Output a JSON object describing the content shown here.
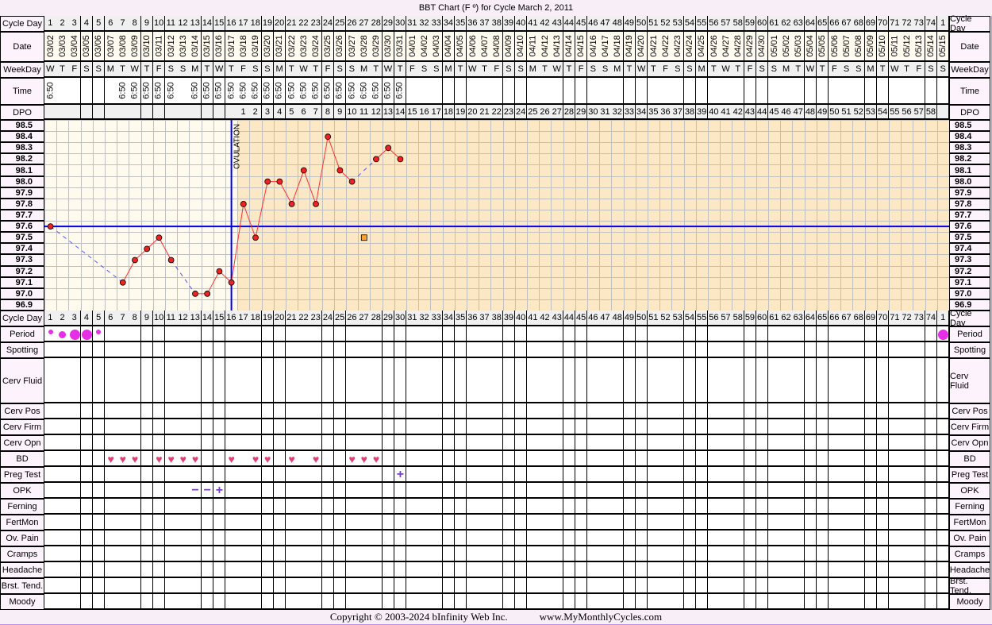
{
  "title": "BBT Chart (F º) for Cycle March 2, 2011",
  "copyright": "Copyright © 2003-2024 bInfinity Web Inc.",
  "site": "www.MyMonthlyCycles.com",
  "labels": {
    "cycle_day": "Cycle Day",
    "date": "Date",
    "weekday": "WeekDay",
    "time": "Time",
    "dpo": "DPO",
    "ovulation": "OVULATION"
  },
  "bottom_rows": [
    "Period",
    "Spotting",
    "Cerv Fluid",
    "Cerv Pos",
    "Cerv Firm",
    "Cerv Opn",
    "BD",
    "Preg Test",
    "OPK",
    "Ferning",
    "FertMon",
    "Ov. Pain",
    "Cramps",
    "Headache",
    "Brst. Tend.",
    "Moody"
  ],
  "colors": {
    "pre_ovulation": "#fffaee",
    "post_ovulation": "#fde8c5",
    "temp_line": "#ff3333",
    "coverline": "#0000ee",
    "period": "#e62ee6",
    "bd": "#e0407a",
    "opk": "#7a3fc0"
  },
  "chart_data": {
    "type": "line",
    "title": "BBT Chart (F º) for Cycle March 2, 2011",
    "ylim": [
      96.9,
      98.5
    ],
    "y_ticks": [
      "98.5",
      "98.4",
      "98.3",
      "98.2",
      "98.1",
      "98.0",
      "97.9",
      "97.8",
      "97.7",
      "97.6",
      "97.5",
      "97.4",
      "97.3",
      "97.2",
      "97.1",
      "97.0",
      "96.9"
    ],
    "grid": true,
    "cycle_days": [
      "1",
      "2",
      "3",
      "4",
      "5",
      "6",
      "7",
      "8",
      "9",
      "10",
      "11",
      "12",
      "13",
      "14",
      "15",
      "16",
      "17",
      "18",
      "19",
      "20",
      "21",
      "22",
      "23",
      "24",
      "25",
      "26",
      "27",
      "28",
      "29",
      "30",
      "31",
      "32",
      "33",
      "34",
      "35",
      "36",
      "37",
      "38",
      "39",
      "40",
      "41",
      "42",
      "43",
      "44",
      "45",
      "46",
      "47",
      "48",
      "49",
      "50",
      "51",
      "52",
      "53",
      "54",
      "55",
      "56",
      "57",
      "58",
      "59",
      "60",
      "61",
      "62",
      "63",
      "64",
      "65",
      "66",
      "67",
      "68",
      "69",
      "70",
      "71",
      "72",
      "73",
      "74",
      "1"
    ],
    "dates": [
      "03/02",
      "03/03",
      "03/04",
      "03/05",
      "03/06",
      "03/07",
      "03/08",
      "03/09",
      "03/10",
      "03/11",
      "03/12",
      "03/13",
      "03/14",
      "03/15",
      "03/16",
      "03/17",
      "03/18",
      "03/19",
      "03/20",
      "03/21",
      "03/22",
      "03/23",
      "03/24",
      "03/25",
      "03/26",
      "03/27",
      "03/28",
      "03/29",
      "03/30",
      "03/31",
      "04/01",
      "04/02",
      "04/03",
      "04/04",
      "04/05",
      "04/06",
      "04/07",
      "04/08",
      "04/09",
      "04/10",
      "04/11",
      "04/12",
      "04/13",
      "04/14",
      "04/15",
      "04/16",
      "04/17",
      "04/18",
      "04/19",
      "04/20",
      "04/21",
      "04/22",
      "04/23",
      "04/24",
      "04/25",
      "04/26",
      "04/27",
      "04/28",
      "04/29",
      "04/30",
      "05/01",
      "05/02",
      "05/03",
      "05/04",
      "05/05",
      "05/06",
      "05/07",
      "05/08",
      "05/09",
      "05/10",
      "05/11",
      "05/12",
      "05/13",
      "05/14",
      "05/15"
    ],
    "weekdays": [
      "W",
      "T",
      "F",
      "S",
      "S",
      "M",
      "T",
      "W",
      "T",
      "F",
      "S",
      "S",
      "M",
      "T",
      "W",
      "T",
      "F",
      "S",
      "S",
      "M",
      "T",
      "W",
      "T",
      "F",
      "S",
      "S",
      "M",
      "T",
      "W",
      "T",
      "F",
      "S",
      "S",
      "M",
      "T",
      "W",
      "T",
      "F",
      "S",
      "S",
      "M",
      "T",
      "W",
      "T",
      "F",
      "S",
      "S",
      "M",
      "T",
      "W",
      "T",
      "F",
      "S",
      "S",
      "M",
      "T",
      "W",
      "T",
      "F",
      "S",
      "S",
      "M",
      "T",
      "W",
      "T",
      "F",
      "S",
      "S",
      "M",
      "T",
      "W",
      "T",
      "F",
      "S",
      "S"
    ],
    "times": [
      "6:50",
      "",
      "",
      "",
      "",
      "",
      "6:50",
      "6:50",
      "6:50",
      "6:50",
      "6:50",
      "",
      "6:50",
      "6:50",
      "6:50",
      "6:50",
      "6:50",
      "6:50",
      "6:50",
      "6:50",
      "6:50",
      "6:50",
      "6:50",
      "6:50",
      "6:50",
      "6:50",
      "6:50",
      "6:50",
      "6:50",
      "6:50"
    ],
    "dpo": [
      "",
      "",
      "",
      "",
      "",
      "",
      "",
      "",
      "",
      "",
      "",
      "",
      "",
      "",
      "",
      "",
      "1",
      "2",
      "3",
      "4",
      "5",
      "6",
      "7",
      "8",
      "9",
      "10",
      "11",
      "12",
      "13",
      "14",
      "15",
      "16",
      "17",
      "18",
      "19",
      "20",
      "21",
      "22",
      "23",
      "24",
      "25",
      "26",
      "27",
      "28",
      "29",
      "30",
      "31",
      "32",
      "33",
      "34",
      "35",
      "36",
      "37",
      "38",
      "39",
      "40",
      "41",
      "42",
      "43",
      "44",
      "45",
      "46",
      "47",
      "48",
      "49",
      "50",
      "51",
      "52",
      "53",
      "54",
      "55",
      "56",
      "57",
      "58",
      ""
    ],
    "temps": [
      {
        "day": 1,
        "temp": 97.6
      },
      {
        "day": 7,
        "temp": 97.1
      },
      {
        "day": 8,
        "temp": 97.3
      },
      {
        "day": 9,
        "temp": 97.4
      },
      {
        "day": 10,
        "temp": 97.5
      },
      {
        "day": 11,
        "temp": 97.3
      },
      {
        "day": 13,
        "temp": 97.0
      },
      {
        "day": 14,
        "temp": 97.0
      },
      {
        "day": 15,
        "temp": 97.2
      },
      {
        "day": 16,
        "temp": 97.1
      },
      {
        "day": 17,
        "temp": 97.8
      },
      {
        "day": 18,
        "temp": 97.5
      },
      {
        "day": 19,
        "temp": 98.0
      },
      {
        "day": 20,
        "temp": 98.0
      },
      {
        "day": 21,
        "temp": 97.8
      },
      {
        "day": 22,
        "temp": 98.1
      },
      {
        "day": 23,
        "temp": 97.8
      },
      {
        "day": 24,
        "temp": 98.4
      },
      {
        "day": 25,
        "temp": 98.1
      },
      {
        "day": 26,
        "temp": 98.0
      },
      {
        "day": 28,
        "temp": 98.2
      },
      {
        "day": 29,
        "temp": 98.3
      },
      {
        "day": 30,
        "temp": 98.2
      }
    ],
    "excluded_temps": [
      {
        "day": 27,
        "temp": 97.5
      }
    ],
    "coverline": 97.6,
    "ovulation_day": 16,
    "period": [
      {
        "day": 1,
        "size": "small"
      },
      {
        "day": 2,
        "size": "medium"
      },
      {
        "day": 3,
        "size": "large"
      },
      {
        "day": 4,
        "size": "large"
      },
      {
        "day": 5,
        "size": "small"
      },
      {
        "day": 75,
        "size": "large"
      }
    ],
    "bd_days": [
      6,
      7,
      8,
      10,
      11,
      12,
      13,
      16,
      18,
      19,
      21,
      23,
      26,
      27,
      28
    ],
    "preg_test": [
      {
        "day": 30,
        "result": "+"
      }
    ],
    "opk": [
      {
        "day": 13,
        "result": "−"
      },
      {
        "day": 14,
        "result": "−"
      },
      {
        "day": 15,
        "result": "+"
      }
    ]
  }
}
